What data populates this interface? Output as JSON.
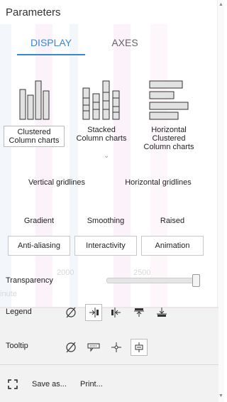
{
  "panel": {
    "title": "Parameters"
  },
  "tabs": [
    {
      "label": "DISPLAY",
      "active": true
    },
    {
      "label": "AXES",
      "active": false
    }
  ],
  "chart_types": [
    {
      "label": "Clustered Column charts",
      "selected": true
    },
    {
      "label": "Stacked Column charts",
      "selected": false
    },
    {
      "label": "Horizontal Clustered Column charts",
      "selected": false
    }
  ],
  "gridlines": {
    "vertical": "Vertical gridlines",
    "horizontal": "Horizontal gridlines"
  },
  "effects": {
    "gradient": "Gradient",
    "smoothing": "Smoothing",
    "raised": "Raised"
  },
  "toggles": {
    "anti_aliasing": "Anti-aliasing",
    "interactivity": "Interactivity",
    "animation": "Animation"
  },
  "background": {
    "tick_2000": "2000",
    "tick_2500": "2500",
    "axis_word": "inute"
  },
  "transparency": {
    "label": "Transparency",
    "value_percent": 100
  },
  "legend": {
    "label": "Legend",
    "options": [
      "none-icon",
      "legend-right-icon",
      "legend-left-icon",
      "legend-top-icon",
      "legend-bottom-icon"
    ],
    "selected": "legend-right-icon"
  },
  "tooltip": {
    "label": "Tooltip",
    "options": [
      "none-icon",
      "tooltip-box-icon",
      "crosshair-icon",
      "crosshair-box-icon"
    ],
    "selected": "crosshair-box-icon"
  },
  "footer": {
    "save_label": "Save as...",
    "print_label": "Print..."
  },
  "colors": {
    "accent": "#3a86d1"
  }
}
